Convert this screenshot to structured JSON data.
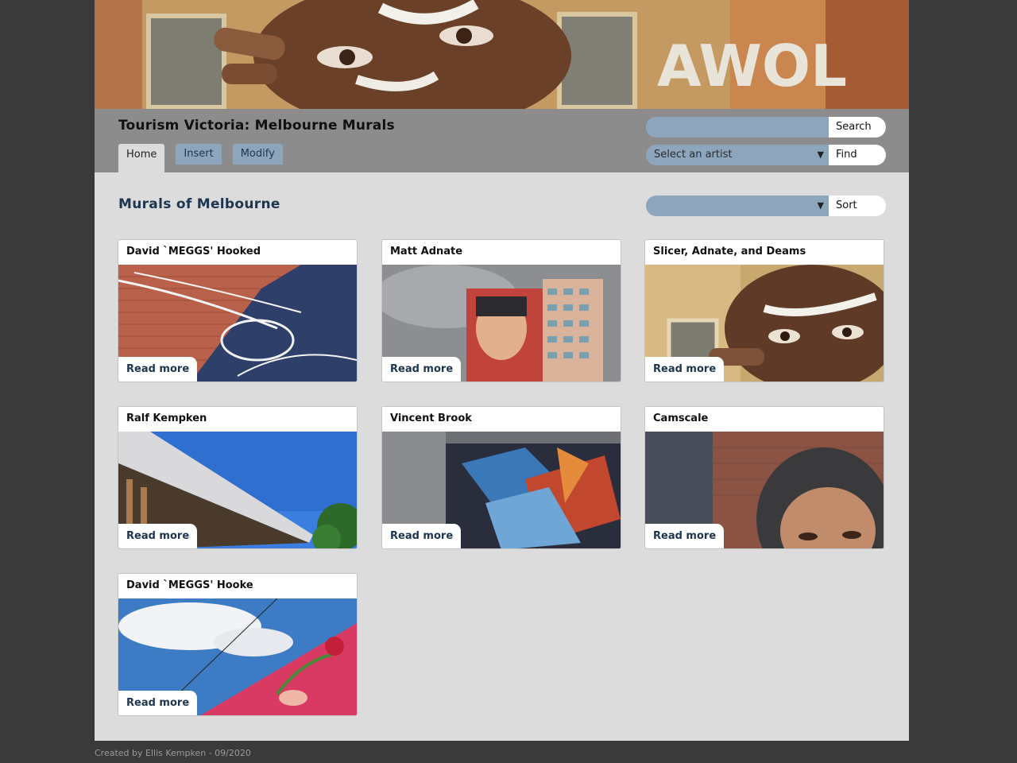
{
  "site": {
    "title": "Tourism Victoria: Melbourne Murals",
    "banner_text": "AWOL"
  },
  "nav": {
    "tabs": [
      {
        "label": "Home",
        "active": true
      },
      {
        "label": "Insert",
        "active": false
      },
      {
        "label": "Modify",
        "active": false
      }
    ]
  },
  "search": {
    "value": "",
    "placeholder": "",
    "button_label": "Search"
  },
  "artist_filter": {
    "selected": "Select an artist",
    "button_label": "Find"
  },
  "main": {
    "heading": "Murals of Melbourne",
    "sort": {
      "selected": "",
      "button_label": "Sort"
    },
    "cards": [
      {
        "artist": "David `MEGGS' Hooked",
        "link_label": "Read more"
      },
      {
        "artist": "Matt Adnate",
        "link_label": "Read more"
      },
      {
        "artist": "Slicer, Adnate, and Deams",
        "link_label": "Read more"
      },
      {
        "artist": "Ralf Kempken",
        "link_label": "Read more"
      },
      {
        "artist": "Vincent Brook",
        "link_label": "Read more"
      },
      {
        "artist": "Camscale",
        "link_label": "Read more"
      },
      {
        "artist": "David `MEGGS' Hooke",
        "link_label": "Read more"
      }
    ]
  },
  "footer": {
    "text": "Created by Ellis Kempken - 09/2020"
  },
  "colors": {
    "accent": "#8ea6bd",
    "heading": "#1e3550",
    "header_bg": "#8c8c8c",
    "page_bg": "#dcdcdc",
    "outer_bg": "#3a3a3a"
  }
}
